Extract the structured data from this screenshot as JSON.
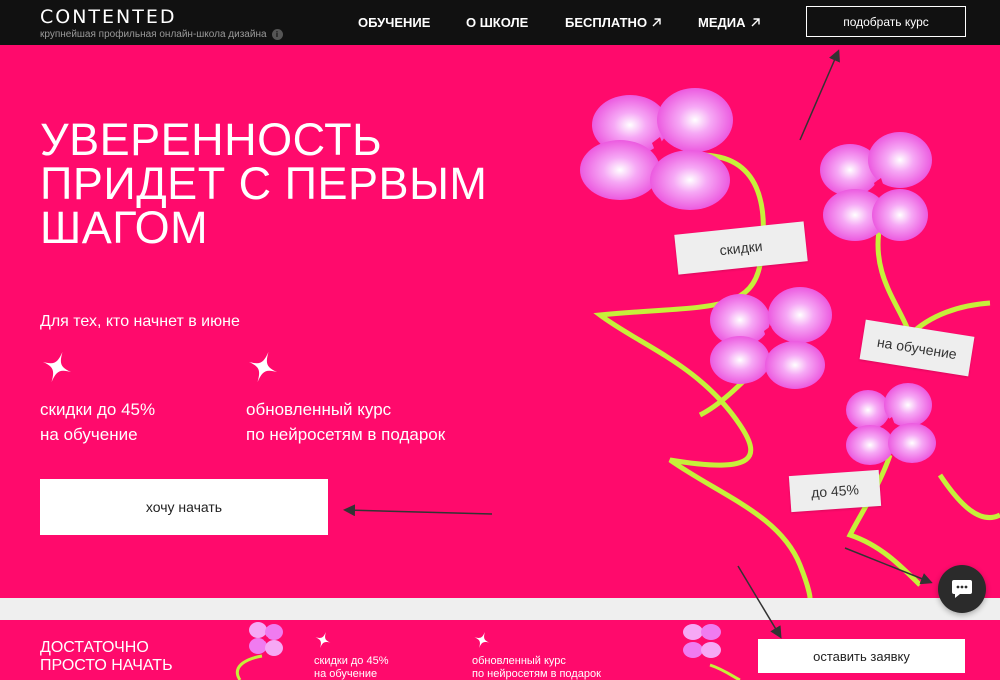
{
  "header": {
    "logo": "CONTENTED",
    "tagline": "крупнейшая профильная онлайн-школа дизайна",
    "nav": [
      {
        "label": "ОБУЧЕНИЕ"
      },
      {
        "label": "О ШКОЛЕ"
      },
      {
        "label": "БЕСПЛАТНО",
        "icon": "arrow-up-right-icon"
      },
      {
        "label": "МЕДИА",
        "icon": "arrow-up-right-icon"
      }
    ],
    "cta": "подобрать курс"
  },
  "hero": {
    "title_lines": [
      "УВЕРЕННОСТЬ",
      "ПРИДЕТ С ПЕРВЫМ",
      "ШАГОМ"
    ],
    "subtitle": "Для тех, кто начнет в июне",
    "features": [
      {
        "lines": [
          "скидки до 45%",
          "на обучение"
        ],
        "icon": "sparkle-icon"
      },
      {
        "lines": [
          "обновленный курс",
          "по нейросетям в подарок"
        ],
        "icon": "sparkle-icon"
      }
    ],
    "cta": "хочу начать",
    "tapes": [
      "скидки",
      "на обучение",
      "до 45%"
    ]
  },
  "bottom_bar": {
    "title_lines": [
      "ДОСТАТОЧНО",
      "ПРОСТО НАЧАТЬ"
    ],
    "features": [
      {
        "lines": [
          "скидки до 45%",
          "на обучение"
        ]
      },
      {
        "lines": [
          "обновленный курс",
          "по нейросетям в подарок"
        ]
      }
    ],
    "cta": "оставить заявку"
  },
  "colors": {
    "brand_pink": "#ff0a6c",
    "header_bg": "#111111",
    "stem_green": "#c6f03a",
    "flower_pink": "#f07bf0"
  },
  "chat": {
    "icon": "chat-bubble-icon"
  }
}
